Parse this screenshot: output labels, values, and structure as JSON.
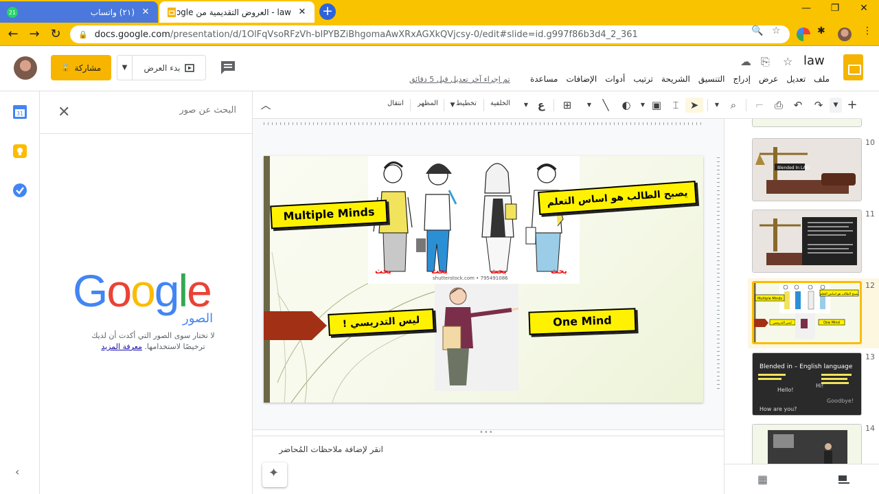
{
  "browser": {
    "tabs": [
      {
        "title": "(٢١) واتساب",
        "active": false
      },
      {
        "title": "law - العروض التقديمية من Google",
        "active": true
      }
    ],
    "tab_close": "✕",
    "new_tab": "+",
    "window_controls": [
      "—",
      "❐",
      "✕"
    ],
    "url": "docs.google.com/presentation/d/1OlFqVsoRFzVh-bIPYBZiBhgomaAwXRxAGXkQVjcsy-0/edit#slide=id.g997f86b3d4_2_361",
    "url_host": "docs.google.com",
    "url_path": "/presentation/d/1OlFqVsoRFzVh-bIPYBZiBhgomaAwXRxAGXkQVjcsy-0/edit#slide=id.g997f86b3d4_2_361"
  },
  "doc": {
    "title": "law",
    "share_label": "مشاركة",
    "present_label": "بدء العرض",
    "menus": [
      "ملف",
      "تعديل",
      "عرض",
      "إدراج",
      "التنسيق",
      "الشريحة",
      "ترتيب",
      "أدوات",
      "الإضافات",
      "مساعدة"
    ],
    "last_edit": "تم إجراء آخر تعديل قبل 5 دقائق"
  },
  "toolbar": {
    "transition": "انتقال",
    "theme": "المظهر",
    "layout": "تخطيط",
    "background": "الخلفية"
  },
  "image_search": {
    "placeholder": "البحث عن صور",
    "logo": "Google",
    "images_label": "الصور",
    "note": "لا تختار سوى الصور التي أكدت أن لديك ترخيصًا لاستخدامها.",
    "learn_more": "معرفة المزيد"
  },
  "slide": {
    "callout_top_right": "يصبح الطالب هو اساس التعلم",
    "callout_multiple": "Multiple Minds",
    "callout_not_teaching": "ليس التدريسي !",
    "callout_one_mind": "One Mind",
    "research_labels": [
      "بحث",
      "بحث",
      "بحث",
      "بحث"
    ],
    "watermark": "shutterstock.com • 795491086"
  },
  "notes": {
    "placeholder": "انقر لإضافة ملاحظات المُحاضر"
  },
  "filmstrip": {
    "numbers": [
      "10",
      "11",
      "12",
      "13",
      "14"
    ],
    "selected": "12",
    "thumb12_labels": [
      "Multiple Minds",
      "يصبح الطالب هو اساس التعلم",
      "One Mind",
      "ليس التدريسي"
    ],
    "thumb13_title": "Blended in – English language",
    "thumb13_words": [
      "Hello!",
      "Hi!",
      "How are you?",
      "Goodbye!"
    ],
    "thumb10_label": "Blended In LAW"
  },
  "colors": {
    "chrome_frame": "#fac300",
    "share_button": "#f7b500",
    "selected_thumb": "#fbbc04",
    "callout_fill": "#fff200",
    "slide_arrow": "#a23014"
  }
}
